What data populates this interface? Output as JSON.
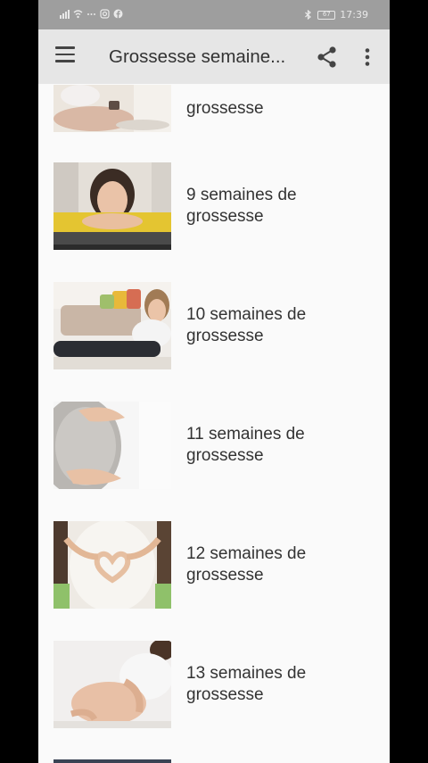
{
  "status_bar": {
    "time": "17:39",
    "battery": "67"
  },
  "app_bar": {
    "title": "Grossesse semaine..."
  },
  "items": [
    {
      "label": "grossesse"
    },
    {
      "label": "9 semaines de grossesse"
    },
    {
      "label": "10 semaines de grossesse"
    },
    {
      "label": "11 semaines de grossesse"
    },
    {
      "label": "12 semaines de grossesse"
    },
    {
      "label": "13 semaines de grossesse"
    }
  ],
  "colors": {
    "status_bar": "#9e9e9e",
    "app_bar": "#e6e6e6",
    "background": "#fafafa",
    "text": "#333333"
  }
}
